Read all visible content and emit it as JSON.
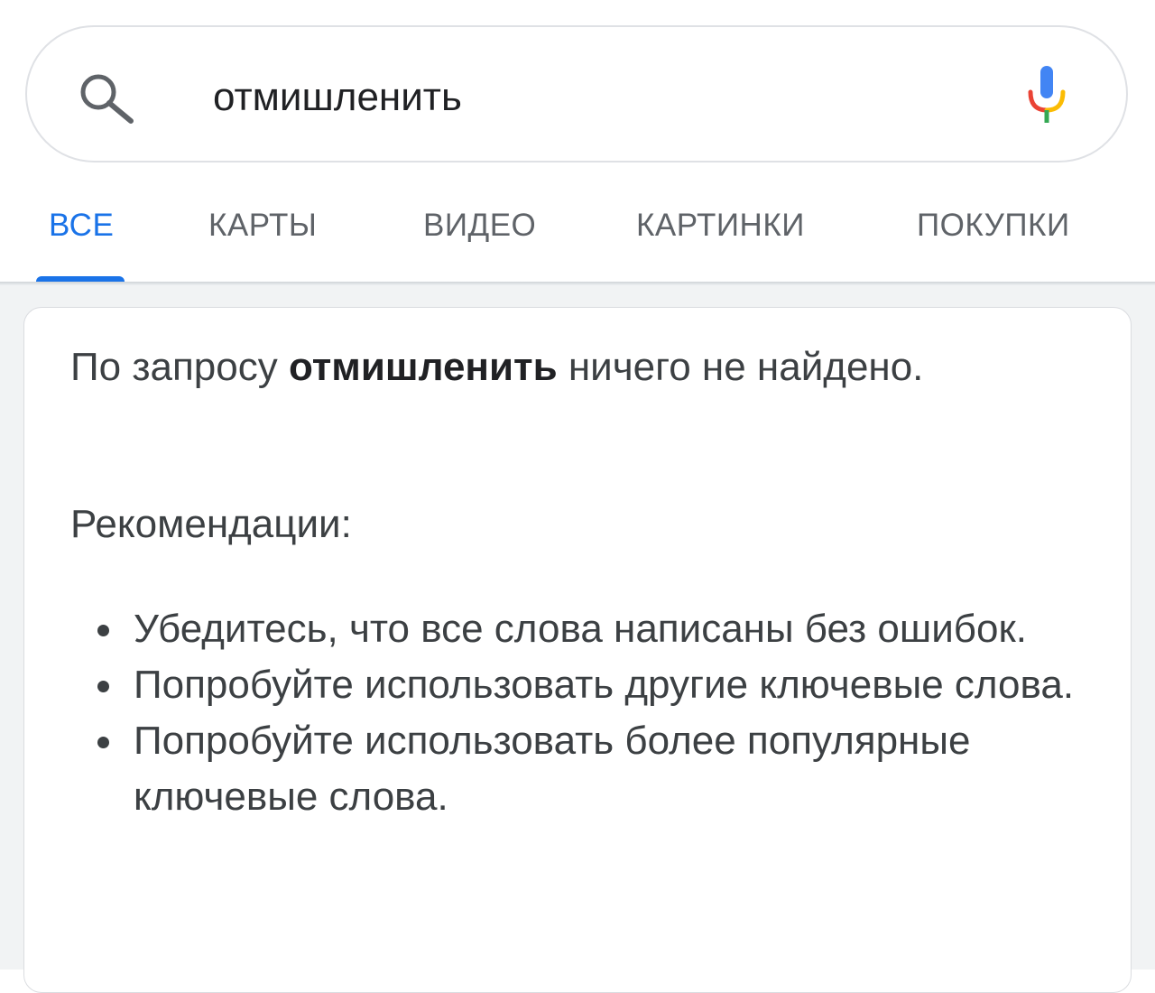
{
  "search": {
    "query": "отмишленить",
    "icons": {
      "search": "search-icon",
      "mic": "mic-icon"
    }
  },
  "tabs": [
    {
      "label": "ВСЕ",
      "active": true
    },
    {
      "label": "КАРТЫ",
      "active": false
    },
    {
      "label": "ВИДЕО",
      "active": false
    },
    {
      "label": "КАРТИНКИ",
      "active": false
    },
    {
      "label": "ПОКУПКИ",
      "active": false
    }
  ],
  "result": {
    "notice_prefix": "По запросу",
    "notice_query": "отмишленить",
    "notice_suffix": "ничего не найдено.",
    "recommendations_heading": "Рекомендации:",
    "recommendations": [
      "Убедитесь, что все слова написаны без ошибок.",
      "Попробуйте использовать другие ключевые слова.",
      "Попробуйте использовать более популярные ключевые слова."
    ]
  },
  "colors": {
    "accent": "#1a73e8",
    "tab_inactive": "#5f6368",
    "text": "#3c4043",
    "mic_blue": "#4285f4",
    "mic_red": "#ea4335",
    "mic_yellow": "#fbbc04",
    "mic_green": "#34a853"
  }
}
